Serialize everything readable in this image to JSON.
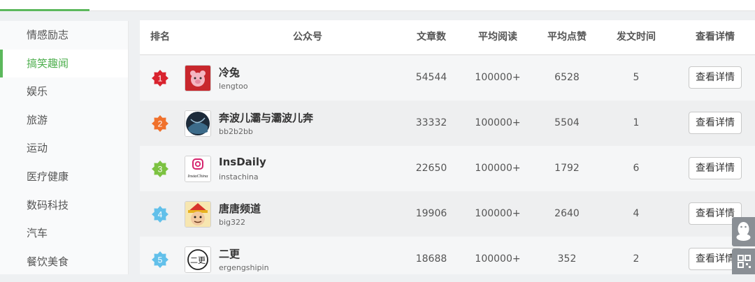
{
  "sidebar": {
    "items": [
      {
        "label": "情感励志"
      },
      {
        "label": "搞笑趣闻"
      },
      {
        "label": "娱乐"
      },
      {
        "label": "旅游"
      },
      {
        "label": "运动"
      },
      {
        "label": "医疗健康"
      },
      {
        "label": "数码科技"
      },
      {
        "label": "汽车"
      },
      {
        "label": "餐饮美食"
      }
    ],
    "active_index": 1
  },
  "table": {
    "headers": {
      "rank": "排名",
      "account": "公众号",
      "articles": "文章数",
      "avg_reads": "平均阅读",
      "avg_likes": "平均点赞",
      "post_time": "发文时间",
      "details": "查看详情"
    },
    "rows": [
      {
        "rank": "1",
        "name": "冷兔",
        "id": "lengtoo",
        "articles": "54544",
        "avg_reads": "100000+",
        "avg_likes": "6528",
        "post_time": "5",
        "button": "查看详情",
        "badge_color": "#d9232e",
        "avatar_icon": "pig-avatar-icon"
      },
      {
        "rank": "2",
        "name": "奔波儿灞与灞波儿奔",
        "id": "bb2b2bb",
        "articles": "33332",
        "avg_reads": "100000+",
        "avg_likes": "5504",
        "post_time": "1",
        "button": "查看详情",
        "badge_color": "#f0712c",
        "avatar_icon": "dark-circle-avatar-icon"
      },
      {
        "rank": "3",
        "name": "InsDaily",
        "id": "instachina",
        "articles": "22650",
        "avg_reads": "100000+",
        "avg_likes": "1792",
        "post_time": "6",
        "button": "查看详情",
        "badge_color": "#7cc241",
        "avatar_icon": "instagram-avatar-icon",
        "avatar_text": "InstaChina"
      },
      {
        "rank": "4",
        "name": "唐唐频道",
        "id": "big322",
        "articles": "19906",
        "avg_reads": "100000+",
        "avg_likes": "2640",
        "post_time": "4",
        "button": "查看详情",
        "badge_color": "#62c0ea",
        "avatar_icon": "cartoon-face-avatar-icon"
      },
      {
        "rank": "5",
        "name": "二更",
        "id": "ergengshipin",
        "articles": "18688",
        "avg_reads": "100000+",
        "avg_likes": "352",
        "post_time": "2",
        "button": "查看详情",
        "badge_color": "#62c0ea",
        "avatar_icon": "ergeng-logo-avatar-icon",
        "avatar_text": "二更"
      }
    ]
  },
  "float_buttons": {
    "qq_icon": "qq-penguin-icon",
    "qr_icon": "qr-code-icon"
  },
  "colors": {
    "accent": "#5cb85c"
  }
}
